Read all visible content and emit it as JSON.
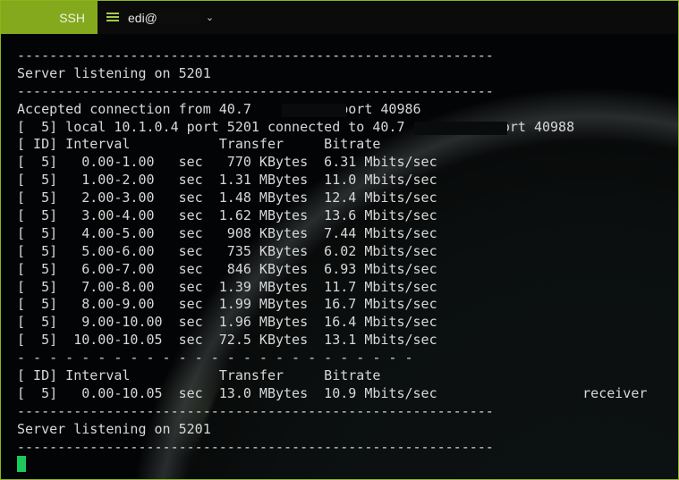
{
  "window": {
    "tab_active_label": "SSH",
    "tab_session_label": "edi@",
    "tab_session_icon": "hamburger-icon",
    "tab_dropdown_icon": "chevron-down-icon",
    "accent_color": "#84a91c",
    "cursor_color": "#1ec85a"
  },
  "terminal": {
    "lines": [
      "-----------------------------------------------------------",
      "Server listening on 5201",
      "-----------------------------------------------------------",
      "Accepted connection from 40.7         , port 40986",
      "[  5] local 10.1.0.4 port 5201 connected to 40.7           port 40988",
      "[ ID] Interval           Transfer     Bitrate",
      "[  5]   0.00-1.00   sec   770 KBytes  6.31 Mbits/sec",
      "[  5]   1.00-2.00   sec  1.31 MBytes  11.0 Mbits/sec",
      "[  5]   2.00-3.00   sec  1.48 MBytes  12.4 Mbits/sec",
      "[  5]   3.00-4.00   sec  1.62 MBytes  13.6 Mbits/sec",
      "[  5]   4.00-5.00   sec   908 KBytes  7.44 Mbits/sec",
      "[  5]   5.00-6.00   sec   735 KBytes  6.02 Mbits/sec",
      "[  5]   6.00-7.00   sec   846 KBytes  6.93 Mbits/sec",
      "[  5]   7.00-8.00   sec  1.39 MBytes  11.7 Mbits/sec",
      "[  5]   8.00-9.00   sec  1.99 MBytes  16.7 Mbits/sec",
      "[  5]   9.00-10.00  sec  1.96 MBytes  16.4 Mbits/sec",
      "[  5]  10.00-10.05  sec  72.5 KBytes  13.1 Mbits/sec",
      "- - - - - - - - - - - - - - - - - - - - - - - - -",
      "[ ID] Interval           Transfer     Bitrate",
      "[  5]   0.00-10.05  sec  13.0 MBytes  10.9 Mbits/sec                  receiver",
      "-----------------------------------------------------------",
      "Server listening on 5201",
      "-----------------------------------------------------------"
    ]
  }
}
